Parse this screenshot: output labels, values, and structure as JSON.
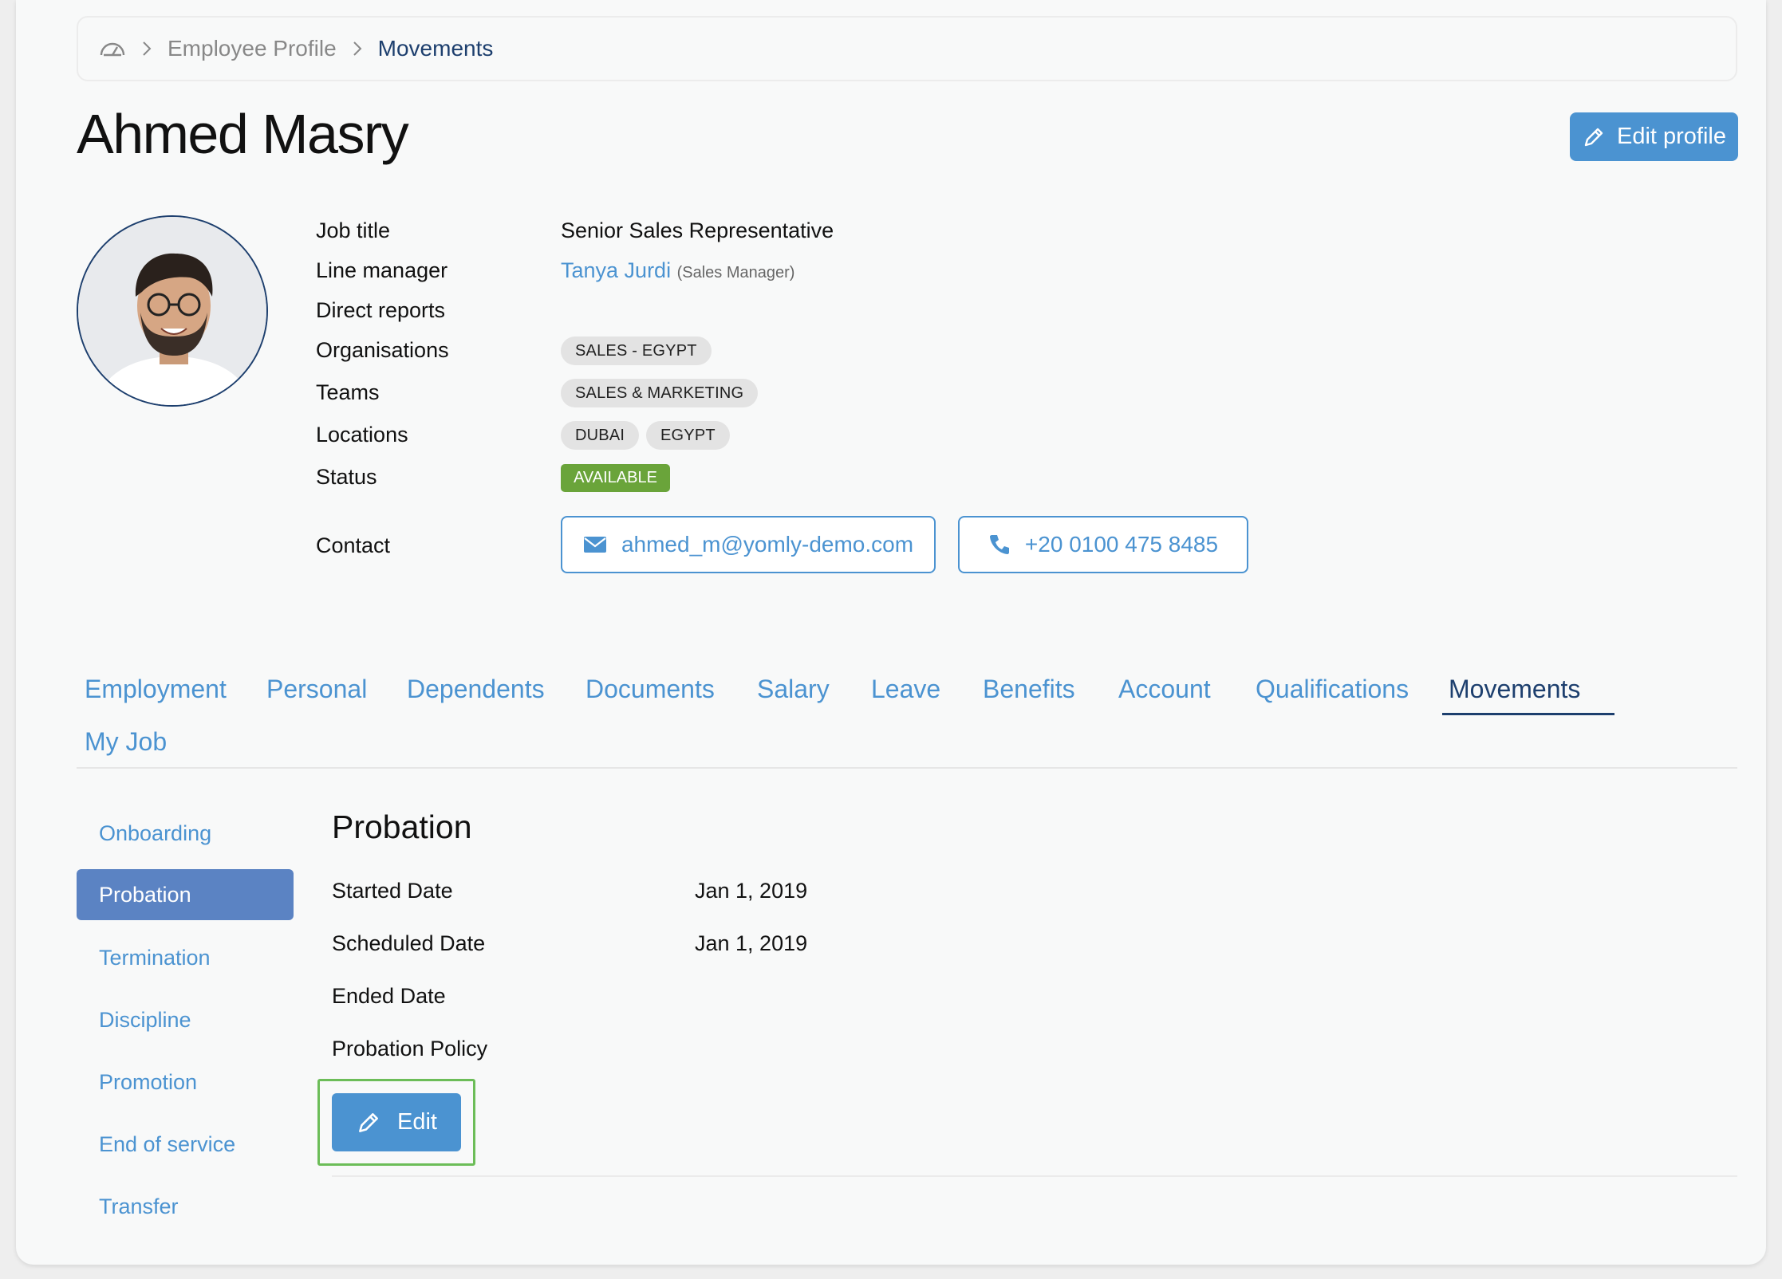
{
  "breadcrumb": {
    "home_icon": "dashboard-icon",
    "items": [
      "Employee Profile",
      "Movements"
    ]
  },
  "employee": {
    "name": "Ahmed Masry",
    "edit_profile_label": "Edit profile"
  },
  "details": {
    "labels": {
      "job_title": "Job title",
      "line_manager": "Line manager",
      "direct_reports": "Direct reports",
      "organisations": "Organisations",
      "teams": "Teams",
      "locations": "Locations",
      "status": "Status",
      "contact": "Contact"
    },
    "job_title": "Senior Sales Representative",
    "line_manager_name": "Tanya Jurdi",
    "line_manager_role": "(Sales Manager)",
    "organisations": [
      "SALES - EGYPT"
    ],
    "teams": [
      "SALES & MARKETING"
    ],
    "locations": [
      "DUBAI",
      "EGYPT"
    ],
    "status": "AVAILABLE",
    "email": "ahmed_m@yomly-demo.com",
    "phone": "+20 0100 475 8485"
  },
  "tabs": [
    "Employment",
    "Personal",
    "Dependents",
    "Documents",
    "Salary",
    "Leave",
    "Benefits",
    "Account",
    "Qualifications",
    "Movements",
    "My Job"
  ],
  "active_tab": "Movements",
  "side_menu": [
    "Onboarding",
    "Probation",
    "Termination",
    "Discipline",
    "Promotion",
    "End of service",
    "Transfer"
  ],
  "active_side": "Probation",
  "probation": {
    "title": "Probation",
    "fields": [
      {
        "label": "Started Date",
        "value": "Jan 1, 2019"
      },
      {
        "label": "Scheduled Date",
        "value": "Jan 1, 2019"
      },
      {
        "label": "Ended Date",
        "value": ""
      },
      {
        "label": "Probation Policy",
        "value": ""
      }
    ],
    "edit_label": "Edit"
  },
  "colors": {
    "accent": "#4b93d1",
    "navy": "#1d3f6e",
    "status_green": "#6aa43a",
    "highlight_green": "#6cbd58",
    "side_active": "#5b83c3"
  }
}
